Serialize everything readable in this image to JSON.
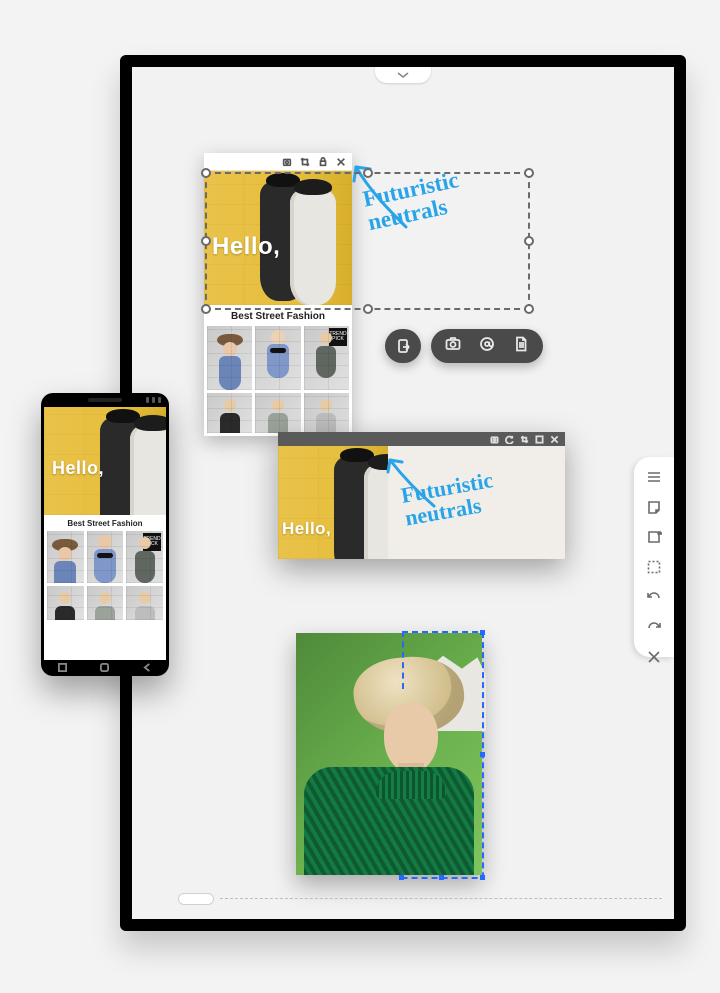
{
  "annotations": {
    "note1_line1": "Futuristic",
    "note1_line2": "neutrals",
    "note2_line1": "Futuristic",
    "note2_line2": "neutrals"
  },
  "hero": {
    "greeting": "Hello,"
  },
  "mirror": {
    "section_title": "Best Street Fashion",
    "badge": "TREND PICK"
  },
  "phone": {
    "section_title": "Best Street Fashion",
    "badge": "TREND PICK"
  },
  "colors": {
    "ink": "#2aa4e8",
    "selection_blue": "#2668ff",
    "pill_bg": "#4a4a4a"
  }
}
